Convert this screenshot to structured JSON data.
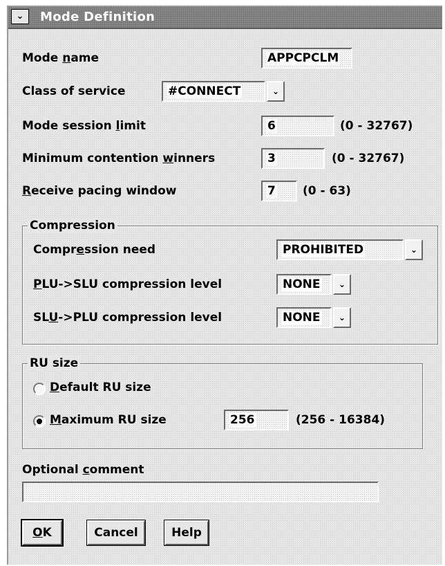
{
  "window": {
    "title": "Mode Definition",
    "sysmenu_glyph": "⌄"
  },
  "form": {
    "mode_name": {
      "label_pre": "Mode ",
      "label_u": "n",
      "label_post": "ame",
      "value": "APPCPCLM"
    },
    "class_of_service": {
      "label": "Class of service",
      "value": "#CONNECT"
    },
    "mode_session_limit": {
      "label_pre": "Mode session ",
      "label_u": "l",
      "label_post": "imit",
      "value": "6",
      "range": "(0 - 32767)"
    },
    "min_contention_winners": {
      "label_pre": "Minimum contention ",
      "label_u": "w",
      "label_post": "inners",
      "value": "3",
      "range": "(0 - 32767)"
    },
    "receive_pacing_window": {
      "label_pre": "",
      "label_u": "R",
      "label_post": "eceive pacing window",
      "value": "7",
      "range": "(0 - 63)"
    }
  },
  "compression": {
    "legend": "Compression",
    "need": {
      "label_pre": "Compr",
      "label_u": "e",
      "label_post": "ssion need",
      "value": "PROHIBITED"
    },
    "plu_slu": {
      "label_pre": "",
      "label_u": "P",
      "label_post": "LU->SLU compression level",
      "value": "NONE"
    },
    "slu_plu": {
      "label_pre": "SL",
      "label_u": "U",
      "label_post": "->PLU compression level",
      "value": "NONE"
    }
  },
  "ru_size": {
    "legend": "RU size",
    "default_option": {
      "label_pre": "",
      "label_u": "D",
      "label_post": "efault RU size",
      "selected": false
    },
    "max_option": {
      "label_pre": "",
      "label_u": "M",
      "label_post": "aximum RU size",
      "selected": true
    },
    "value": "256",
    "range": "(256 - 16384)"
  },
  "comment": {
    "label_pre": "Optional ",
    "label_u": "c",
    "label_post": "omment",
    "value": ""
  },
  "buttons": {
    "ok": {
      "label_u": "O",
      "label_post": "K"
    },
    "cancel": "Cancel",
    "help": "Help"
  },
  "dropdown_glyph": "⌄",
  "colors": {
    "titlebar": "#8a8a8a",
    "dialog_bg": "#e6e6e6",
    "field_bg": "#f2f2f2"
  }
}
